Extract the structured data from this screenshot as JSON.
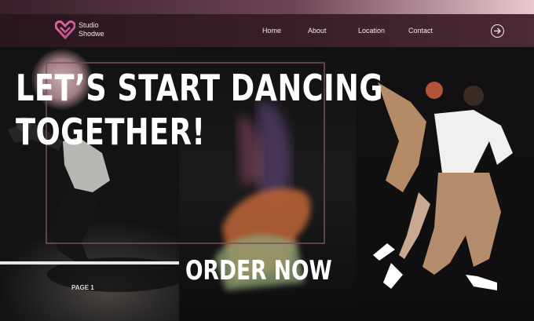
{
  "brand": {
    "line1": "Studio",
    "line2": "Shodwe"
  },
  "nav": {
    "items": [
      "Home",
      "About",
      "Location",
      "Contact"
    ]
  },
  "hero": {
    "headline_line1": "LET’S START DANCING",
    "headline_line2": "TOGETHER!",
    "cta": "ORDER NOW",
    "page_label": "PAGE 1"
  },
  "colors": {
    "accent": "#c45a8a",
    "nav_bg": "#3b1f2a",
    "text": "#ffffff"
  }
}
